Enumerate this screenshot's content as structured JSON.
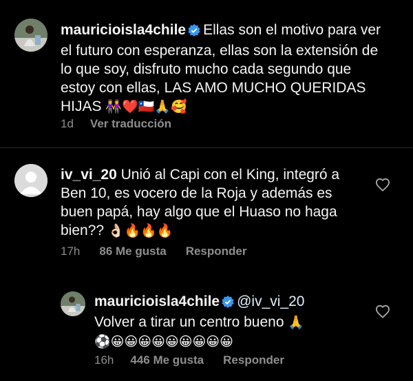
{
  "comments": [
    {
      "username": "mauricioisla4chile",
      "verified": true,
      "text": "Ellas son el motivo para ver  el futuro con esperanza, ellas son la extensión de lo que soy, disfruto mucho cada segundo que estoy con ellas, LAS AMO MUCHO QUERIDAS HIJAS",
      "emojis": "👭❤️🇨🇱🙏🥰",
      "time": "1d",
      "action": "Ver traducción",
      "avatar_icon": "profile-photo"
    },
    {
      "username": "iv_vi_20",
      "verified": false,
      "text": "Unió al Capi con el King, integró a Ben 10, es vocero de la Roja y además es buen papá, hay algo que el Huaso no haga bien??",
      "emojis": "👌🏻🔥🔥🔥",
      "time": "17h",
      "likes": "86 Me gusta",
      "action": "Responder",
      "avatar_icon": "default-avatar"
    }
  ],
  "reply": {
    "username": "mauricioisla4chile",
    "verified": true,
    "mention": "@iv_vi_20",
    "text": "Volver a tirar un centro bueno",
    "emojis_line1": "🙏",
    "emojis_line2": "⚽😀😀😀😀😀😀😀😀😀",
    "time": "16h",
    "likes": "446 Me gusta",
    "action": "Responder"
  },
  "colors": {
    "background": "#000000",
    "text": "#f5f5f5",
    "muted": "#8e8e8e",
    "verified": "#3897f0"
  }
}
